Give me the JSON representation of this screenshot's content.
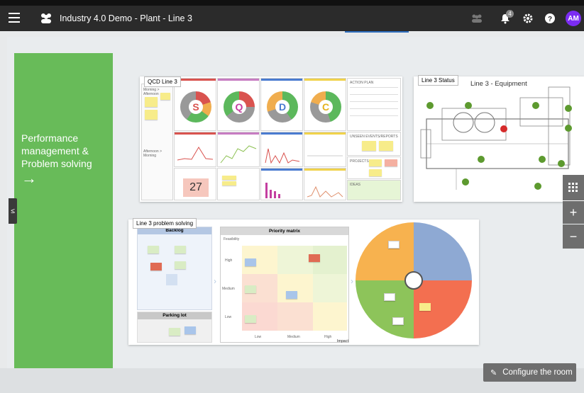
{
  "header": {
    "title": "Industry 4.0 Demo - Plant - Line 3",
    "notification_count": "4",
    "avatar_initials": "AM"
  },
  "green_panel": {
    "lines": [
      "Performance",
      "management &",
      "Problem solving"
    ],
    "arrow": "→"
  },
  "boards": {
    "qcd": {
      "label": "QCD Line 3",
      "letters": [
        "S",
        "Q",
        "D",
        "C"
      ],
      "big_number": "27",
      "sections": [
        "Morning > Afternoon",
        "Afternoon > Morning",
        "ACTION PLAN",
        "UNSEEN EVENTS/REPORTS",
        "PROJECTS",
        "IDEAS"
      ]
    },
    "status": {
      "label": "Line 3 Status",
      "title": "Line 3 - Equipment"
    },
    "problem": {
      "label": "Line 3 problem solving",
      "backlog": "Backlog",
      "parking": "Parking lot",
      "matrix_title": "Priority matrix",
      "feasibility": "Feasibility",
      "impact": "Impact",
      "x_low": "Low",
      "x_medium": "Medium",
      "x_high": "High",
      "y_high": "High",
      "y_medium": "Medium",
      "y_low": "Low"
    }
  },
  "controls": {
    "grid_icon": "grid-icon",
    "zoom_in": "+",
    "zoom_out": "−",
    "configure_label": "Configure the room"
  },
  "colors": {
    "topbar": "#2b2b2b",
    "accent_green": "#68bb59",
    "avatar": "#7b2cf2",
    "pie_orange": "#f7b24f",
    "pie_blue": "#8ea9d3",
    "pie_green": "#8dc45a",
    "pie_red": "#f36f50"
  }
}
